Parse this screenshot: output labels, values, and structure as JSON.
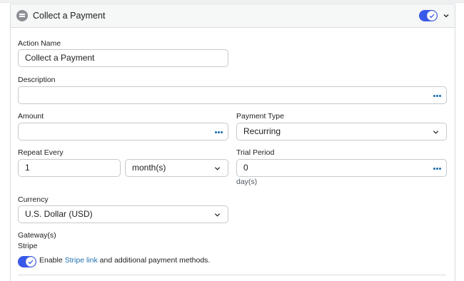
{
  "header": {
    "title": "Collect a Payment",
    "icon": "payment-card-icon",
    "enabled": true
  },
  "form": {
    "action_name": {
      "label": "Action Name",
      "value": "Collect a Payment"
    },
    "description": {
      "label": "Description",
      "value": ""
    },
    "amount": {
      "label": "Amount",
      "value": ""
    },
    "payment_type": {
      "label": "Payment Type",
      "value": "Recurring"
    },
    "repeat_every": {
      "label": "Repeat Every",
      "value": "1",
      "unit": "month(s)"
    },
    "trial_period": {
      "label": "Trial Period",
      "value": "0",
      "hint": "day(s)"
    },
    "currency": {
      "label": "Currency",
      "value": "U.S. Dollar (USD)"
    },
    "gateways": {
      "label": "Gateway(s)",
      "name": "Stripe",
      "stripe_link_enabled": true,
      "text_before": "Enable",
      "link_text": "Stripe link",
      "text_after": "and additional payment methods."
    }
  },
  "colors": {
    "accent": "#3858e9",
    "link": "#2271b1",
    "border": "#c7c9cc"
  }
}
